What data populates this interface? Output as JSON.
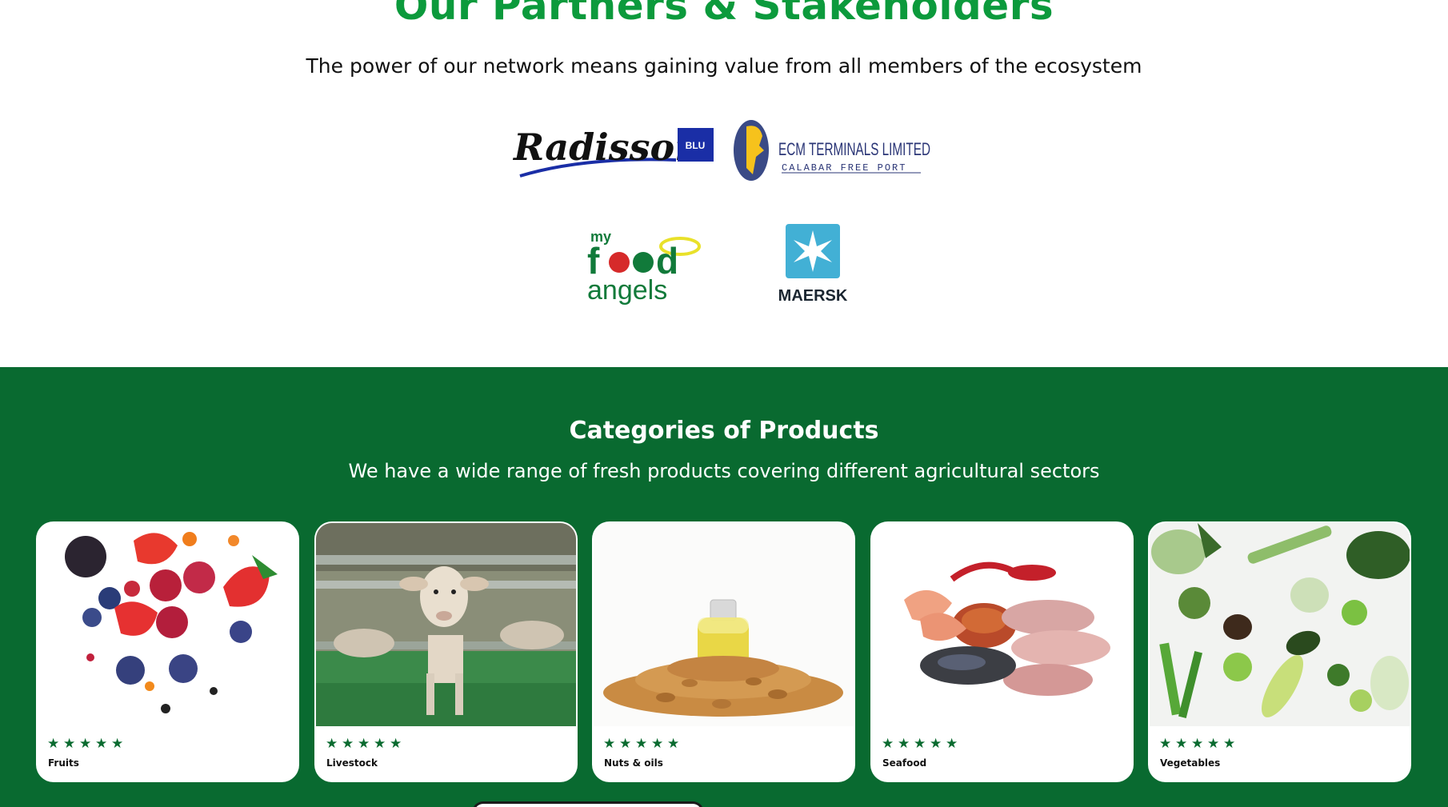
{
  "partners": {
    "title": "Our Partners & Stakeholders",
    "subtitle": "The power of our network means gaining value from all members of the ecosystem",
    "logos": [
      {
        "name": "radisson-blu-logo",
        "text": "Radisson",
        "badge": "BLU"
      },
      {
        "name": "ecm-terminals-logo",
        "text": "ECM TERMINALS LIMITED",
        "subtext": "CALABAR FREE PORT"
      },
      {
        "name": "myfoodangels-logo",
        "text": "my food angels"
      },
      {
        "name": "maersk-logo",
        "text": "MAERSK"
      }
    ]
  },
  "categories": {
    "title": "Categories of Products",
    "subtitle": "We have a wide range of fresh products covering different agricultural sectors",
    "rating_stars": 5,
    "items": [
      {
        "label": "Fruits",
        "rating": 5
      },
      {
        "label": "Livestock",
        "rating": 5
      },
      {
        "label": "Nuts & oils",
        "rating": 5
      },
      {
        "label": "Seafood",
        "rating": 5
      },
      {
        "label": "Vegetables",
        "rating": 5
      }
    ]
  },
  "colors": {
    "accent_green": "#0c9a3c",
    "section_green": "#096a30",
    "star_green": "#0b6b30",
    "radisson_blue": "#1a2ea6",
    "maersk_blue": "#42b0d5"
  }
}
